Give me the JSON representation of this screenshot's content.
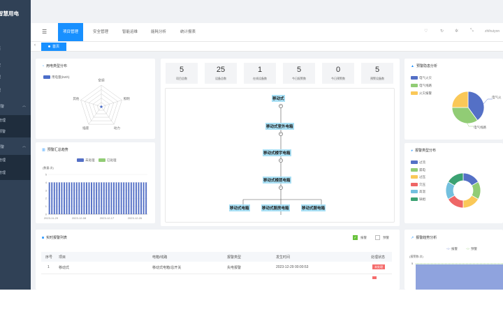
{
  "sidebar": {
    "brand": "智慧用电",
    "items": [
      {
        "label": "页"
      },
      {
        "label": "控"
      },
      {
        "label": "理"
      },
      {
        "label": "理"
      },
      {
        "label": "预警"
      },
      {
        "label": "管理"
      },
      {
        "label": "预警"
      },
      {
        "label": "管理"
      },
      {
        "label": "管理"
      }
    ]
  },
  "navbar": {
    "menu_icon": "☰",
    "tabs": [
      {
        "label": "项目管理"
      },
      {
        "label": "安全管理"
      },
      {
        "label": "智能运维"
      },
      {
        "label": "能耗分析"
      },
      {
        "label": "统计报表"
      }
    ],
    "user": "zhihuiyon"
  },
  "tagsbar": {
    "back": "‹",
    "active_tag": "首页"
  },
  "power_dist": {
    "title": "用电类型分布",
    "legend": "用电量(kWh)",
    "chart_data": {
      "type": "radar",
      "indicators": [
        "空调",
        "照明",
        "动力",
        "插座",
        "其他"
      ],
      "series": [
        {
          "name": "用电量(kWh)",
          "values": [
            0,
            0,
            0,
            0,
            0
          ]
        }
      ],
      "color": "#4c6ec9"
    }
  },
  "alarm_trend": {
    "title": "预警汇总趋势",
    "legend": [
      "未处理",
      "已处理"
    ],
    "ylabel": "(数量:次)",
    "chart_data": {
      "type": "bar",
      "x_ticks": [
        "2023-11-29",
        "2023-12-08",
        "2023-12-17",
        "2023-12-26"
      ],
      "y_ticks": [
        "0",
        "1",
        "2",
        "3",
        "4",
        "5"
      ],
      "ylim": [
        0,
        5
      ],
      "bar_count": 40,
      "series": [
        {
          "name": "未处理",
          "value": 4,
          "color": "#5470c6"
        },
        {
          "name": "已处理",
          "value": 0,
          "color": "#91cc75"
        }
      ]
    }
  },
  "stats": [
    {
      "value": "5",
      "label": "项目总数"
    },
    {
      "value": "25",
      "label": "设备总数"
    },
    {
      "value": "1",
      "label": "在线设备数"
    },
    {
      "value": "5",
      "label": "今日报警数"
    },
    {
      "value": "0",
      "label": "今日预警数"
    },
    {
      "value": "5",
      "label": "预警设备数"
    }
  ],
  "tree": {
    "root": "移动式",
    "level1": "移动式室外电箱",
    "level2": "移动式楼宇电箱",
    "level3": "移动式楼层电箱",
    "leaves": [
      "移动式电箱",
      "移动式厨房电箱",
      "移动式厨电箱"
    ],
    "toggle": "−"
  },
  "alarm_types": {
    "title": "预警隐患分析",
    "chart_data": {
      "type": "pie",
      "labels": [
        "电气火灾",
        "电气线路",
        "火灾报警"
      ],
      "values": [
        40,
        35,
        25
      ],
      "colors": [
        "#5470c6",
        "#91cc75",
        "#fac858"
      ]
    },
    "outer_labels": [
      "电气火",
      "电气线路"
    ]
  },
  "alarm_dist": {
    "title": "报警类型分布",
    "chart_data": {
      "type": "pie",
      "donut": true,
      "labels": [
        "过流",
        "漏电",
        "过压",
        "欠压",
        "高温",
        "缺相"
      ],
      "values": [
        1,
        1,
        1,
        1,
        1,
        1
      ],
      "colors": [
        "#5470c6",
        "#91cc75",
        "#fac858",
        "#ee6666",
        "#73c0de",
        "#3ba272"
      ]
    }
  },
  "realtime": {
    "title": "实时报警列表",
    "filters": [
      {
        "label": "报警",
        "checked": true
      },
      {
        "label": "预警",
        "checked": false
      }
    ],
    "columns": [
      "序号",
      "项目",
      "电箱/线路",
      "报警类型",
      "发生时间",
      "处理状态"
    ],
    "rows": [
      {
        "no": "1",
        "project": "移动式",
        "device": "移动式电箱/总开关",
        "type": "失电报警",
        "time": "2023-12-29 00:00:53",
        "status": "未处理"
      }
    ]
  },
  "alarm_stat": {
    "title": "报警趋势分析",
    "legend": [
      "报警",
      "预警"
    ],
    "ylabel": "(报警数:次)",
    "chart_data": {
      "type": "area",
      "series": [
        {
          "name": "报警",
          "color": "#5470c6"
        },
        {
          "name": "预警",
          "color": "#91cc75"
        }
      ],
      "y_ticks": [
        "5"
      ]
    }
  }
}
